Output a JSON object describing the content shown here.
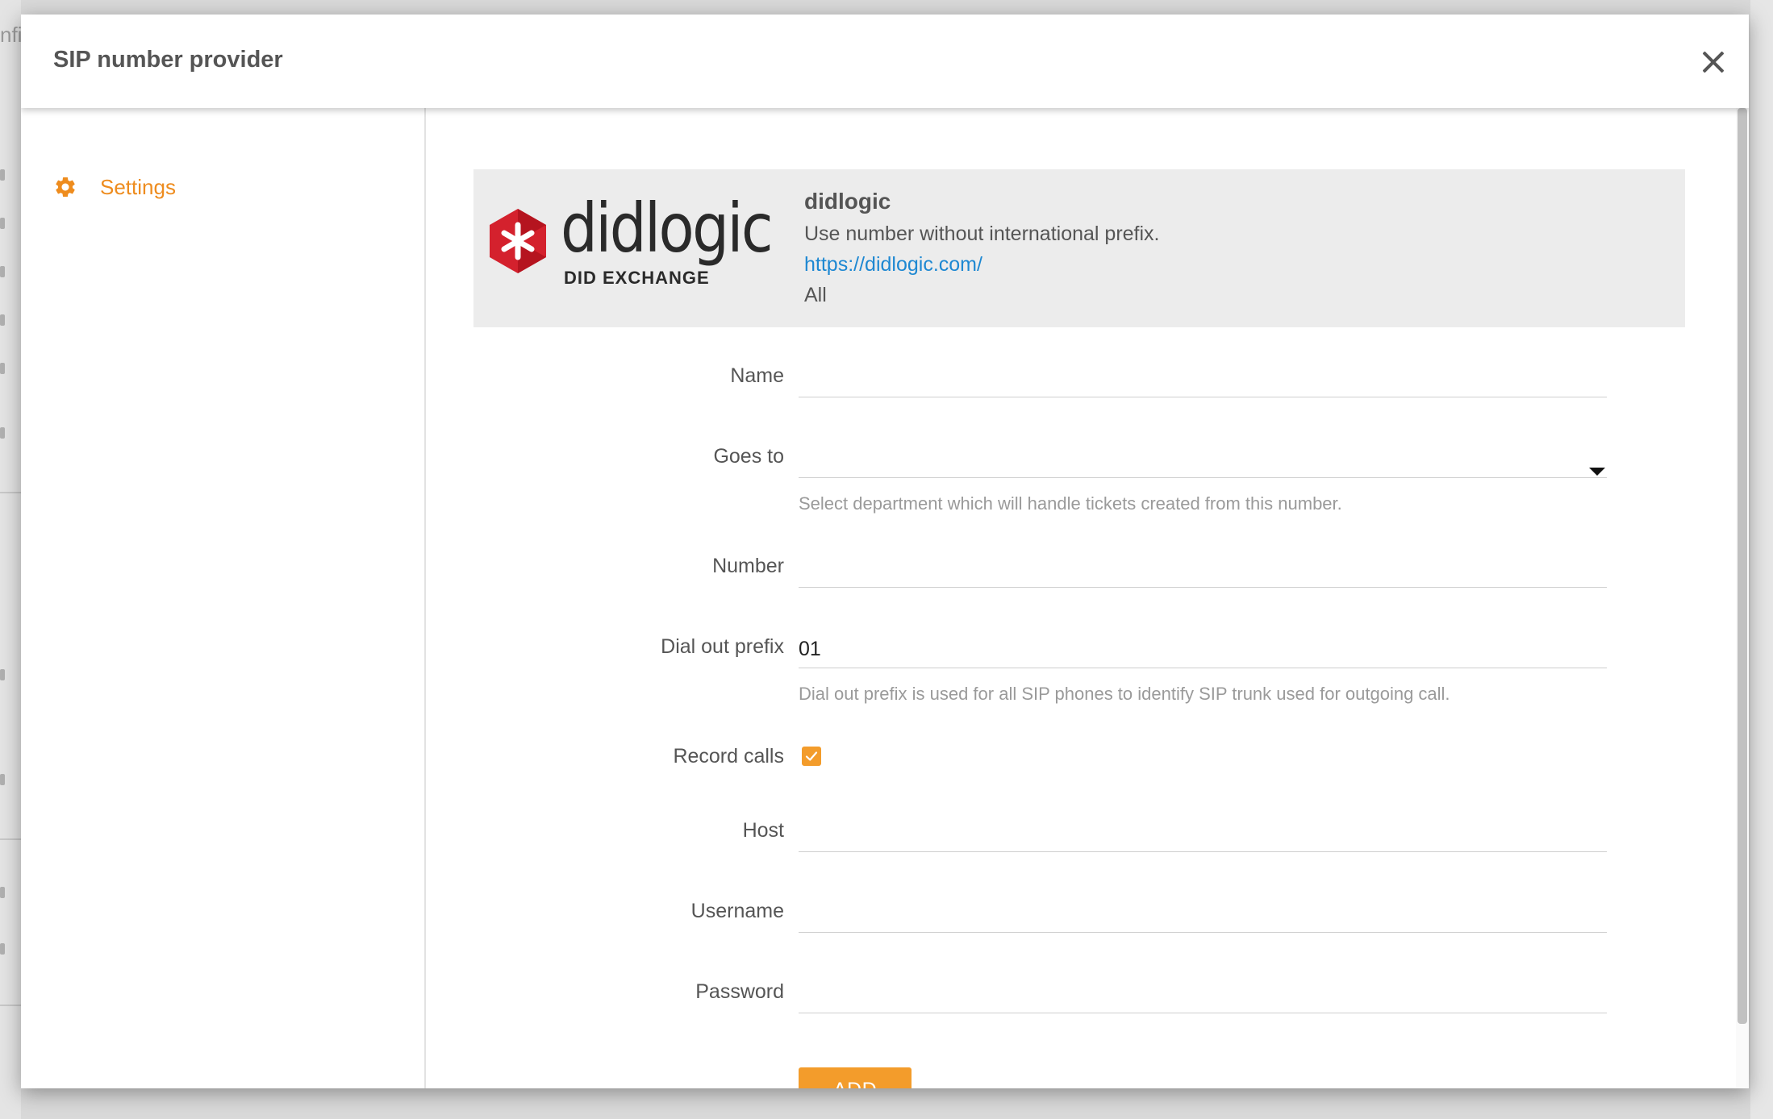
{
  "background": {
    "partial_text": "nfi"
  },
  "modal": {
    "title": "SIP number provider",
    "close_icon": "close-icon"
  },
  "sidebar": {
    "items": [
      {
        "label": "Settings",
        "icon": "gear-icon",
        "active": true
      }
    ]
  },
  "provider": {
    "logo_text": "didlogic",
    "logo_subtext": "DID EXCHANGE",
    "name": "didlogic",
    "description": "Use number without international prefix.",
    "url": "https://didlogic.com/",
    "scope": "All"
  },
  "form": {
    "name": {
      "label": "Name",
      "value": ""
    },
    "goes_to": {
      "label": "Goes to",
      "value": "",
      "hint": "Select department which will handle tickets created from this number."
    },
    "number": {
      "label": "Number",
      "value": ""
    },
    "dial_out_prefix": {
      "label": "Dial out prefix",
      "value": "01",
      "hint": "Dial out prefix is used for all SIP phones to identify SIP trunk used for outgoing call."
    },
    "record_calls": {
      "label": "Record calls",
      "checked": true
    },
    "host": {
      "label": "Host",
      "value": ""
    },
    "username": {
      "label": "Username",
      "value": ""
    },
    "password": {
      "label": "Password",
      "value": ""
    },
    "submit_label": "ADD"
  },
  "colors": {
    "accent": "#f39c2b",
    "sidebar_active": "#ee8c1e",
    "link": "#1e88d2",
    "logo_red": "#d4212d"
  }
}
